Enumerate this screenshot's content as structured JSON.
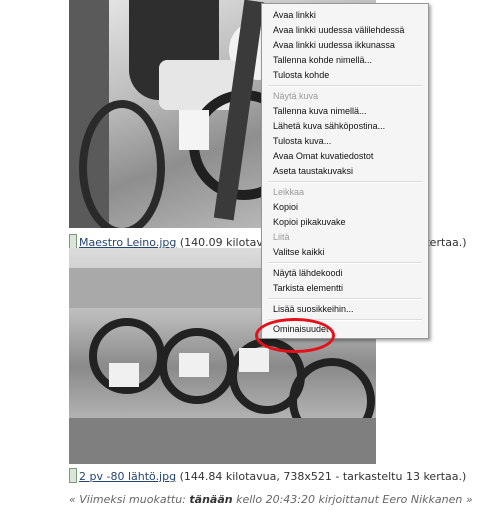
{
  "attachments": [
    {
      "file_link": "Maestro Leino.jpg",
      "info": " (140.09 kilotavua, 738x521 - tarkasteltu 13 kertaa.)"
    },
    {
      "file_link": "2 pv -80 lähtö.jpg",
      "info": " (144.84 kilotavua, 738x521 - tarkasteltu 13 kertaa.)"
    }
  ],
  "context_menu": {
    "items": [
      {
        "label": "Avaa linkki",
        "enabled": true
      },
      {
        "label": "Avaa linkki uudessa välilehdessä",
        "enabled": true
      },
      {
        "label": "Avaa linkki uudessa ikkunassa",
        "enabled": true
      },
      {
        "label": "Tallenna kohde nimellä...",
        "enabled": true
      },
      {
        "label": "Tulosta kohde",
        "enabled": true
      },
      {
        "label": "Näytä kuva",
        "enabled": false
      },
      {
        "label": "Tallenna kuva nimellä...",
        "enabled": true
      },
      {
        "label": "Lähetä kuva sähköpostina...",
        "enabled": true
      },
      {
        "label": "Tulosta kuva...",
        "enabled": true
      },
      {
        "label": "Avaa Omat kuvatiedostot",
        "enabled": true
      },
      {
        "label": "Aseta taustakuvaksi",
        "enabled": true
      },
      {
        "label": "Leikkaa",
        "enabled": false
      },
      {
        "label": "Kopioi",
        "enabled": true
      },
      {
        "label": "Kopioi pikakuvake",
        "enabled": true
      },
      {
        "label": "Liitä",
        "enabled": false
      },
      {
        "label": "Valitse kaikki",
        "enabled": true
      },
      {
        "label": "Näytä lähdekoodi",
        "enabled": true
      },
      {
        "label": "Tarkista elementti",
        "enabled": true
      },
      {
        "label": "Lisää suosikkeihin...",
        "enabled": true
      },
      {
        "label": "Ominaisuudet",
        "enabled": true,
        "highlighted": true
      }
    ]
  },
  "footer": {
    "open": "« Viimeksi muokattu: ",
    "day": "tänään",
    "rest": " kello 20:43:20 kirjoittanut Eero Nikkanen »"
  },
  "colors": {
    "annotation": "#e4101a",
    "link": "#26456f"
  }
}
